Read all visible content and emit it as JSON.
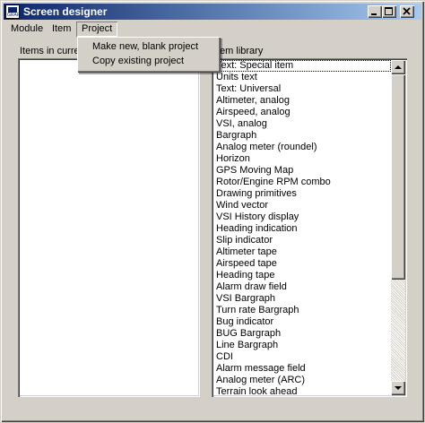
{
  "window": {
    "title": "Screen designer",
    "icon_label": "GRAPH",
    "controls": {
      "minimize": "0",
      "maximize": "1",
      "close": "r"
    }
  },
  "menubar": {
    "items": [
      "Module",
      "Item",
      "Project"
    ],
    "open_menu": "Project"
  },
  "project_menu": {
    "items": [
      "Make new, blank project",
      "Copy existing project"
    ]
  },
  "panels": {
    "left_label": "Items in curre",
    "right_label": "tem library"
  },
  "item_library": {
    "focused_index": 0,
    "items": [
      "Text: Special item",
      "Units text",
      "Text: Universal",
      "Altimeter, analog",
      "Airspeed, analog",
      "VSI, analog",
      "Bargraph",
      "Analog meter (roundel)",
      "Horizon",
      "GPS Moving Map",
      "Rotor/Engine RPM combo",
      "Drawing primitives",
      "Wind vector",
      "VSI History display",
      "Heading indication",
      "Slip indicator",
      "Altimeter tape",
      "Airspeed tape",
      "Heading tape",
      "Alarm draw field",
      "VSI Bargraph",
      "Turn rate Bargraph",
      "Bug indicator",
      "BUG Bargraph",
      "Line Bargraph",
      "CDI",
      "Alarm message field",
      "Analog meter (ARC)",
      "Terrain look ahead"
    ]
  }
}
